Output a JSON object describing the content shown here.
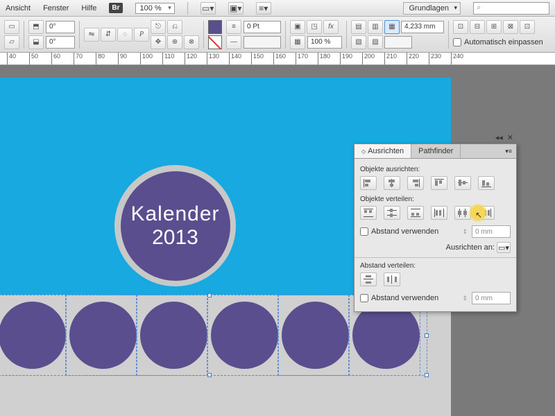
{
  "menu": {
    "ansicht": "Ansicht",
    "fenster": "Fenster",
    "hilfe": "Hilfe",
    "br": "Br",
    "zoom": "100 %",
    "workspace": "Grundlagen",
    "search_placeholder": ""
  },
  "toolbar": {
    "angle1": "0°",
    "angle2": "0°",
    "stroke": "0 Pt",
    "opacity": "100 %",
    "size": "4,233 mm",
    "autofit": "Automatisch einpassen"
  },
  "ruler": {
    "ticks": [
      40,
      50,
      60,
      70,
      80,
      90,
      100,
      110,
      120,
      130,
      140,
      150,
      160,
      170,
      180,
      190,
      200,
      210,
      220,
      230,
      240
    ]
  },
  "canvas": {
    "title_line1": "Kalender",
    "title_line2": "2013"
  },
  "panel": {
    "tab_align": "Ausrichten",
    "tab_pathfinder": "Pathfinder",
    "sec_align": "Objekte ausrichten:",
    "sec_distribute": "Objekte verteilen:",
    "use_spacing": "Abstand verwenden",
    "spacing_val": "0 mm",
    "align_to": "Ausrichten an:",
    "sec_dist_spacing": "Abstand verteilen:",
    "spacing_val2": "0 mm"
  }
}
